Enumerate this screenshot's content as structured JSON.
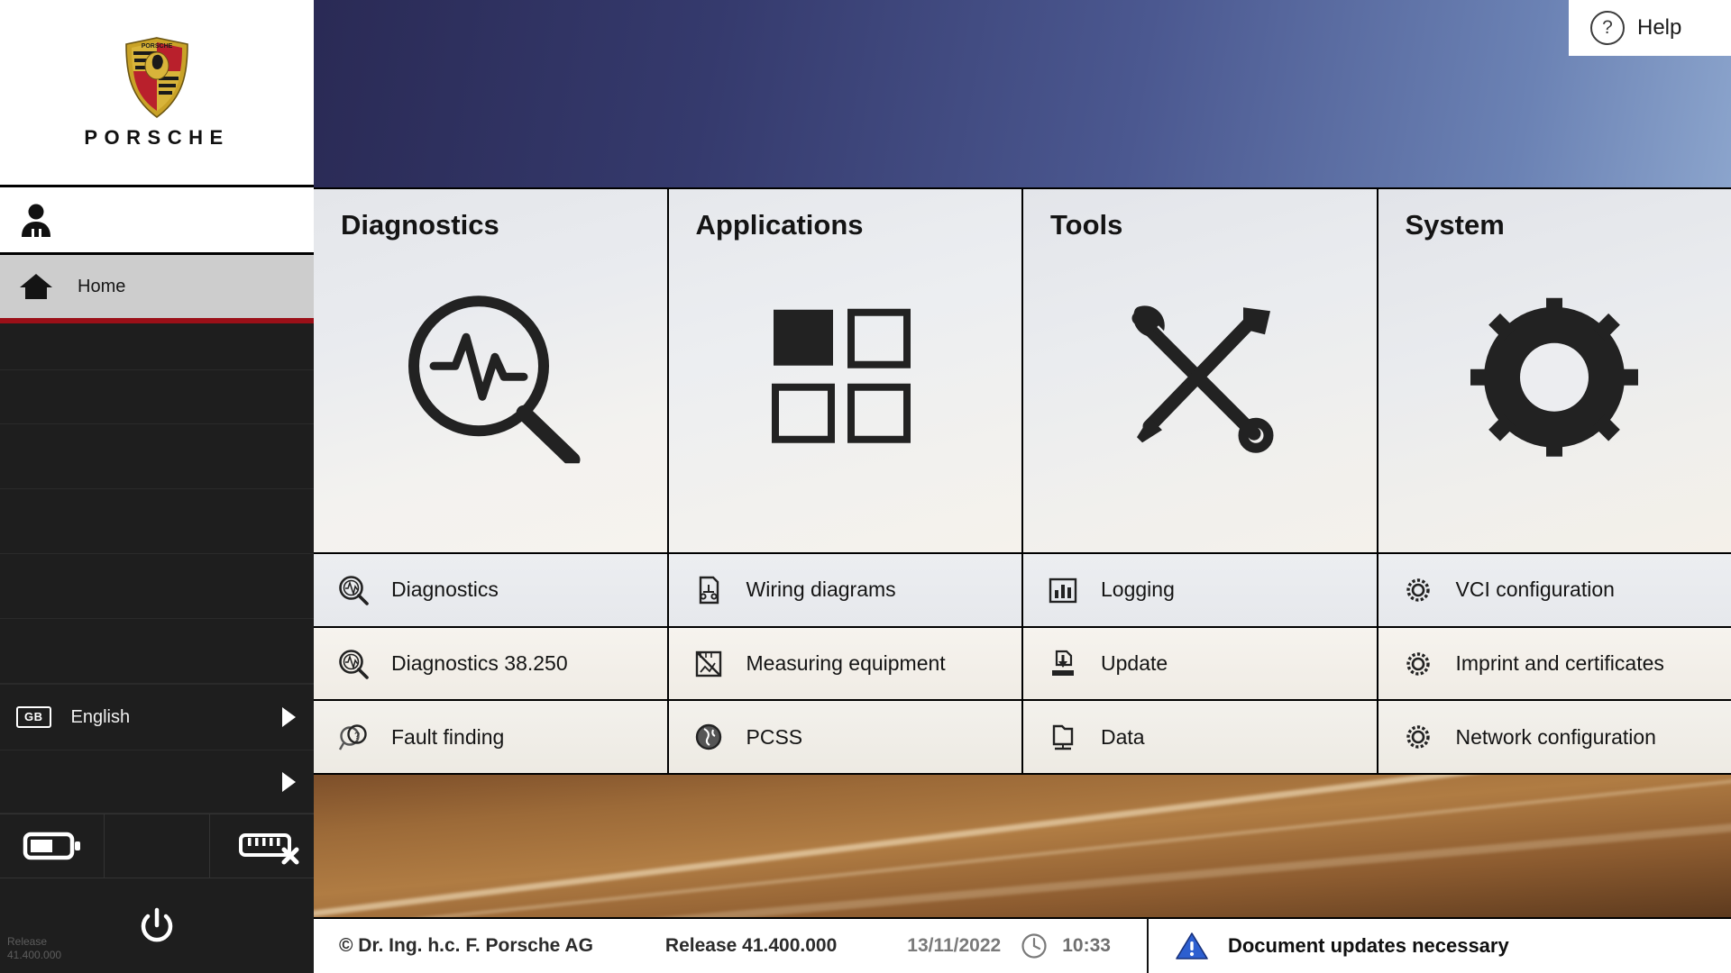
{
  "brand": {
    "name": "PORSCHE",
    "crest_icon": "porsche-crest-icon"
  },
  "sidebar": {
    "user_icon": "user-avatar-icon",
    "nav": [
      {
        "label": "Home",
        "icon": "home-icon",
        "active": true
      }
    ],
    "language": {
      "code": "GB",
      "label": "English",
      "chevron": "chevron-right-icon"
    },
    "status_icons": [
      {
        "name": "battery-icon"
      },
      {
        "name": "empty-slot"
      },
      {
        "name": "vci-connector-icon"
      }
    ],
    "power_icon": "power-icon",
    "release_line1": "Release",
    "release_line2": "41.400.000"
  },
  "help": {
    "label": "Help",
    "icon": "help-question-icon"
  },
  "tiles": [
    {
      "title": "Diagnostics",
      "glyph": "magnifier-pulse-icon",
      "items": [
        {
          "label": "Diagnostics",
          "icon": "magnifier-pulse-icon"
        },
        {
          "label": "Diagnostics 38.250",
          "icon": "magnifier-pulse-icon"
        },
        {
          "label": "Fault finding",
          "icon": "fault-finding-icon"
        }
      ]
    },
    {
      "title": "Applications",
      "glyph": "four-squares-icon",
      "items": [
        {
          "label": "Wiring diagrams",
          "icon": "wiring-diagram-icon"
        },
        {
          "label": "Measuring equipment",
          "icon": "measuring-equipment-icon"
        },
        {
          "label": "PCSS",
          "icon": "globe-icon"
        }
      ]
    },
    {
      "title": "Tools",
      "glyph": "wrench-screwdriver-icon",
      "items": [
        {
          "label": "Logging",
          "icon": "bar-chart-icon"
        },
        {
          "label": "Update",
          "icon": "download-icon"
        },
        {
          "label": "Data",
          "icon": "data-folder-icon"
        }
      ]
    },
    {
      "title": "System",
      "glyph": "gear-icon",
      "items": [
        {
          "label": "VCI configuration",
          "icon": "gear-icon"
        },
        {
          "label": "Imprint and certificates",
          "icon": "gear-icon"
        },
        {
          "label": "Network configuration",
          "icon": "gear-icon"
        }
      ]
    }
  ],
  "statusbar": {
    "copyright": "© Dr. Ing. h.c. F. Porsche AG",
    "release": "Release 41.400.000",
    "date": "13/11/2022",
    "clock_icon": "clock-icon",
    "time": "10:33",
    "warning_icon": "warning-triangle-icon",
    "warning_text": "Document updates necessary"
  },
  "colors": {
    "accent_red": "#9b1018",
    "sidebar_bg": "#1e1e1e",
    "warning_blue": "#2d5fd0"
  }
}
